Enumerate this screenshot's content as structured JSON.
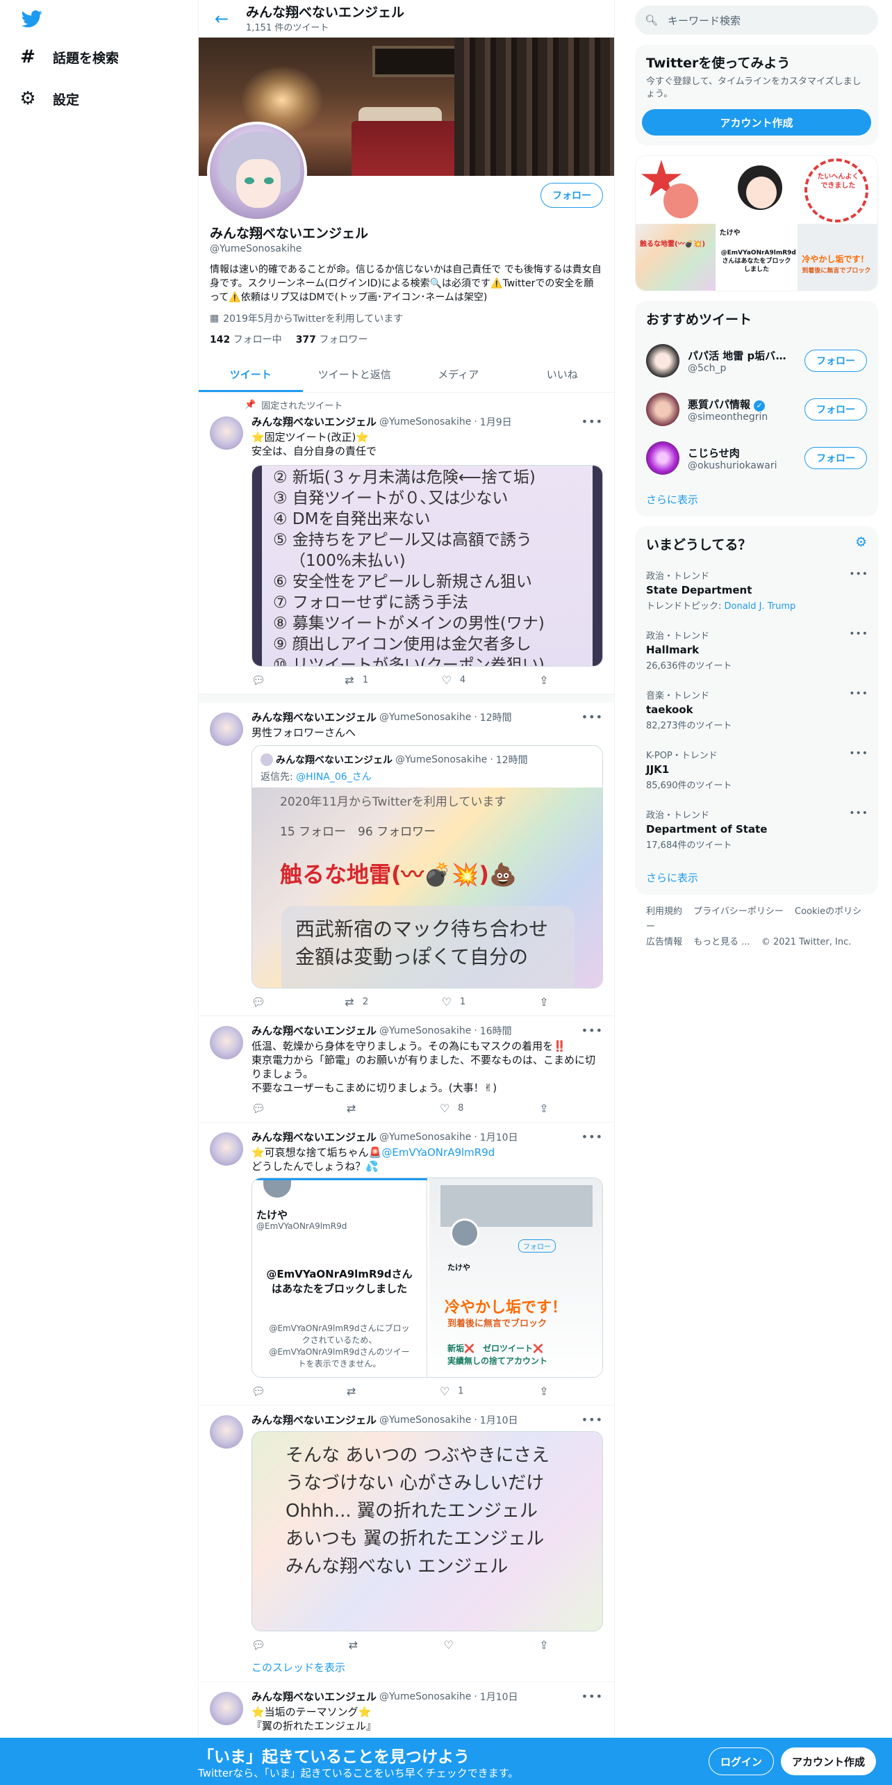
{
  "nav": {
    "logo": "twitter-bird",
    "explore": "話題を検索",
    "settings": "設定"
  },
  "header": {
    "title": "みんな翔べないエンジェル",
    "tweet_count": "1,151 件のツイート"
  },
  "profile": {
    "name": "みんな翔べないエンジェル",
    "handle": "@YumeSonosakihe",
    "follow_label": "フォロー",
    "bio": "情報は速い的確であることが命。信じるか信じないかは自己責任で でも後悔するは貴女自身です。スクリーンネーム(ログインID)による検索🔍は必須です⚠️Twitterでの安全を願って⚠️依頼はリプ又はDMで(トップ画･アイコン･ネームは架空)",
    "joined": "2019年5月からTwitterを利用しています",
    "following_count": "142",
    "following_label": "フォロー中",
    "followers_count": "377",
    "followers_label": "フォロワー"
  },
  "tabs": [
    "ツイート",
    "ツイートと返信",
    "メディア",
    "いいね"
  ],
  "tweets": [
    {
      "pinned_label": "固定されたツイート",
      "name": "みんな翔べないエンジェル",
      "handle": "@YumeSonosakihe",
      "time": "1月9日",
      "text_line1": "⭐固定ツイート(改正)⭐",
      "text_line2": "安全は、自分自身の責任で",
      "image_lines": [
        "② 新垢(３ヶ月未満は危険⟵捨て垢)",
        "③ 自発ツイートが０､又は少ない",
        "④ DMを自発出来ない",
        "⑤ 金持ちをアピール又は高額で誘う",
        "（100%未払い)",
        "⑥ 安全性をアピールし新規さん狙い",
        "⑦ フォローせずに誘う手法",
        "⑧ 募集ツイートがメインの男性(ワナ)",
        "⑨ 顔出しアイコン使用は金欠者多し",
        "⑩ リツイートが多い(クーポン券狙い)"
      ],
      "reply": "",
      "retweet": "1",
      "like": "4"
    },
    {
      "name": "みんな翔べないエンジェル",
      "handle": "@YumeSonosakihe",
      "time": "12時間",
      "text": "男性フォロワーさんへ",
      "quote": {
        "name": "みんな翔べないエンジェル",
        "handle": "@YumeSonosakihe",
        "time": "12時間",
        "reply_to_prefix": "返信先: ",
        "reply_to": "@HINA_06_さん",
        "img_joined": "2020年11月からTwitterを利用しています",
        "img_follow": "15 フォロー　96 フォロワー",
        "img_headline": "触るな地雷(〰💣💥)💩",
        "img_card": "西武新宿のマック待ち合わせ金額は変動っぽくて自分の"
      },
      "reply": "",
      "retweet": "2",
      "like": "1"
    },
    {
      "name": "みんな翔べないエンジェル",
      "handle": "@YumeSonosakihe",
      "time": "16時間",
      "lines": [
        "低温、乾燥から身体を守りましょう。その為にもマスクの着用を‼️",
        "東京電力から「節電」のお願いが有りました、不要なものは、こまめに切りましょう。",
        "不要なユーザーもこまめに切りましょう。(大事！✌)"
      ],
      "reply": "",
      "retweet": "",
      "like": "8"
    },
    {
      "name": "みんな翔べないエンジェル",
      "handle": "@YumeSonosakihe",
      "time": "1月10日",
      "text_line1_prefix": "⭐可哀想な捨て垢ちゃん🚨",
      "text_line1_mention": "@EmVYaONrA9lmR9d",
      "text_line2": "どうしたんでしょうね？💦",
      "left_img": {
        "name": "たけや",
        "handle": "@EmVYaONrA9lmR9d",
        "blocked": "@EmVYaONrA9lmR9dさんはあなたをブロックしました",
        "blocked_sub": "@EmVYaONrA9lmR9dさんにブロックされているため、@EmVYaONrA9lmR9dさんのツイートを表示できません。"
      },
      "right_img": {
        "name": "たけや",
        "follow": "フォロー",
        "headline": "冷やかし垢です！",
        "sub": "到着後に無言でブロック",
        "tag1": "新垢❌　ゼロツイート❌",
        "tag2": "実績無しの捨てアカウント"
      },
      "reply": "",
      "retweet": "",
      "like": "1"
    },
    {
      "name": "みんな翔べないエンジェル",
      "handle": "@YumeSonosakihe",
      "time": "1月10日",
      "poem": [
        "そんな あいつの つぶやきにさえ",
        "うなづけない 心がさみしいだけ",
        "Ohhh... 翼の折れたエンジェル",
        "あいつも 翼の折れたエンジェル",
        "みんな翔べない エンジェル"
      ],
      "show_thread": "このスレッドを表示"
    },
    {
      "name": "みんな翔べないエンジェル",
      "handle": "@YumeSonosakihe",
      "time": "1月10日",
      "text_line1": "⭐当垢のテーマソング⭐",
      "text_line2": "『翼の折れたエンジェル』"
    }
  ],
  "right": {
    "search_placeholder": "キーワード検索",
    "try_title": "Twitterを使ってみよう",
    "try_text": "今すぐ登録して、タイムラインをカスタマイズしましょう。",
    "create_account": "アカウント作成",
    "media_texts": {
      "m4_name": "たけや",
      "m5": "@EmVYaONrA9lmR9dさんはあなたをブロックしました",
      "m6": "冷やかし垢です！",
      "m6_sub": "到着後に無言でブロック",
      "m4_label": "触るな地雷(〰💣💥)",
      "m3": "たいへんよくできました"
    },
    "rec_title": "おすすめツイート",
    "recs": [
      {
        "name": "パパ活 地雷 p垢バトル...",
        "handle": "@5ch_p",
        "follow": "フォロー",
        "color": "#2b2b2b"
      },
      {
        "name": "悪質パパ情報",
        "handle": "@simeonthegrin",
        "follow": "フォロー",
        "color": "#7a3b4a"
      },
      {
        "name": "こじらせ肉",
        "handle": "@okushuriokawari",
        "follow": "フォロー",
        "color": "#b02cd6"
      }
    ],
    "show_more": "さらに表示",
    "trends_title": "いまどうしてる？",
    "trends": [
      {
        "category": "政治・トレンド",
        "name": "State Department",
        "extra_prefix": "トレンドトピック: ",
        "extra_link": "Donald J. Trump"
      },
      {
        "category": "政治・トレンド",
        "name": "Hallmark",
        "extra": "26,636件のツイート"
      },
      {
        "category": "音楽・トレンド",
        "name": "taekook",
        "extra": "82,273件のツイート"
      },
      {
        "category": "K-POP・トレンド",
        "name": "JJK1",
        "extra": "85,690件のツイート"
      },
      {
        "category": "政治・トレンド",
        "name": "Department of State",
        "extra": "17,684件のツイート"
      }
    ],
    "trends_show_more": "さらに表示",
    "footer": [
      "利用規約",
      "プライバシーポリシー",
      "Cookieのポリシー",
      "広告情報",
      "もっと見る ...",
      "© 2021 Twitter, Inc."
    ]
  },
  "bottom": {
    "title": "「いま」起きていることを見つけよう",
    "subtitle": "Twitterなら、「いま」起きていることをいち早くチェックできます。",
    "login": "ログイン",
    "signup": "アカウント作成"
  }
}
